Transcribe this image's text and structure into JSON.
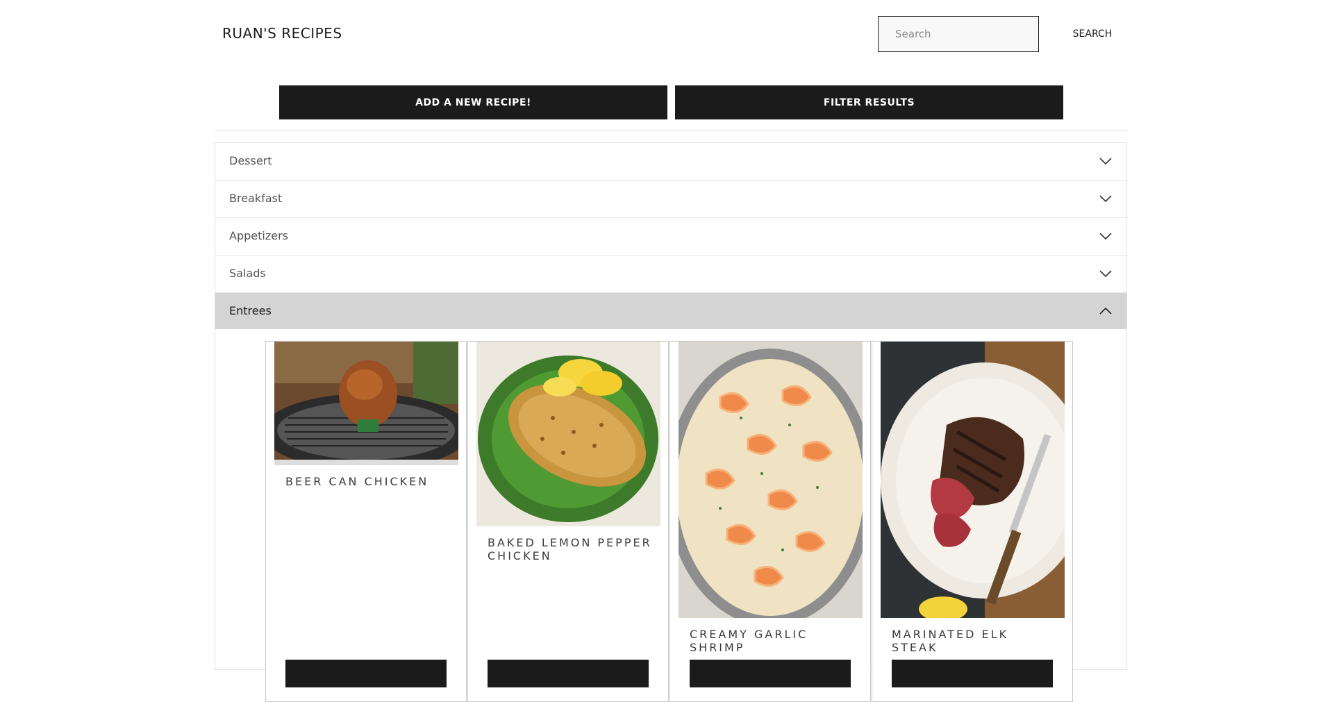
{
  "header": {
    "brand": "RUAN'S RECIPES",
    "search_placeholder": "Search",
    "search_button": "SEARCH"
  },
  "actions": {
    "add_recipe": "ADD A NEW RECIPE!",
    "filter": "FILTER RESULTS"
  },
  "categories": [
    {
      "label": "Dessert",
      "open": false
    },
    {
      "label": "Breakfast",
      "open": false
    },
    {
      "label": "Appetizers",
      "open": false
    },
    {
      "label": "Salads",
      "open": false
    },
    {
      "label": "Entrees",
      "open": true
    }
  ],
  "recipes": [
    {
      "title": "Beer Can Chicken",
      "image": "beer-can-chicken-photo"
    },
    {
      "title": "Baked Lemon Pepper Chicken",
      "image": "lemon-pepper-chicken-photo"
    },
    {
      "title": "Creamy Garlic Shrimp",
      "image": "garlic-shrimp-photo"
    },
    {
      "title": "Marinated Elk Steak",
      "image": "elk-steak-photo"
    }
  ],
  "colors": {
    "primary": "#1b1b1b",
    "open_row": "#d4d4d4",
    "border": "#e0e0e0"
  }
}
